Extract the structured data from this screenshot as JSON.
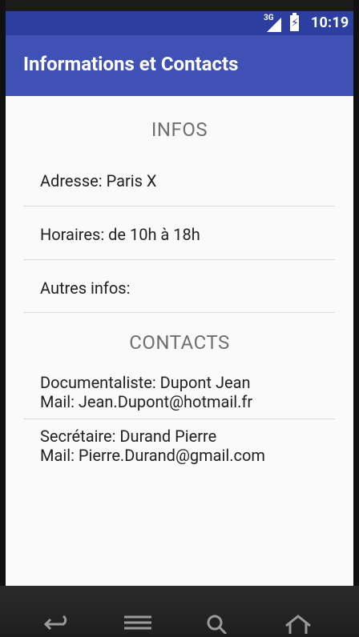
{
  "status_bar": {
    "network": "3G",
    "time": "10:19"
  },
  "app_bar": {
    "title": "Informations et Contacts"
  },
  "infos": {
    "heading": "INFOS",
    "items": [
      {
        "label": "Adresse: Paris X"
      },
      {
        "label": "Horaires: de 10h à 18h"
      },
      {
        "label": "Autres infos:"
      }
    ]
  },
  "contacts": {
    "heading": "CONTACTS",
    "items": [
      {
        "line1": "Documentaliste: Dupont Jean",
        "line2": "Mail: Jean.Dupont@hotmail.fr"
      },
      {
        "line1": "Secrétaire: Durand Pierre",
        "line2": "Mail: Pierre.Durand@gmail.com"
      }
    ]
  },
  "nav_bar": {
    "icons": [
      "back-icon",
      "menu-icon",
      "search-icon",
      "home-icon"
    ]
  },
  "colors": {
    "primary": "#3f51b5",
    "primary_dark": "#2c3e9f",
    "heading_text": "#707070"
  }
}
